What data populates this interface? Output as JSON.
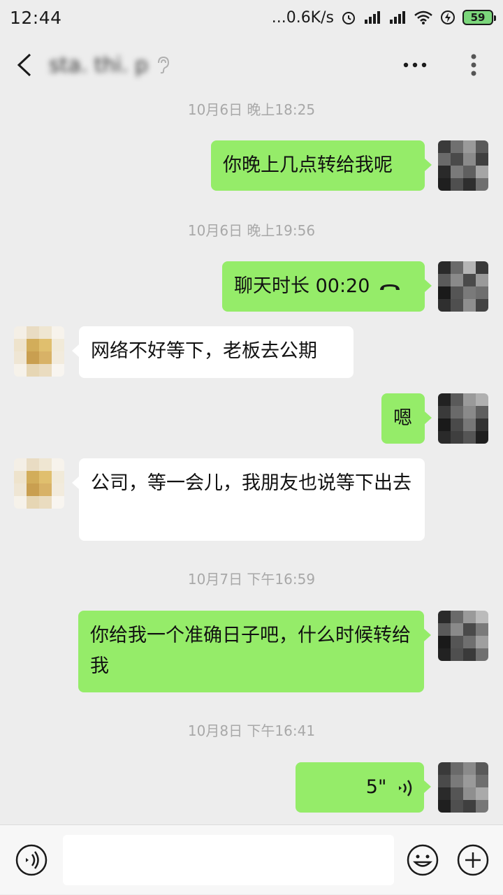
{
  "status_bar": {
    "time": "12:44",
    "network_speed": "...0.6K/s",
    "battery_level": "59"
  },
  "header": {
    "contact_name": "sta. thi. p"
  },
  "messages": [
    {
      "type": "timestamp",
      "text": "10月6日 晚上18:25"
    },
    {
      "type": "text",
      "sender": "me",
      "text": "你晚上几点转给我呢"
    },
    {
      "type": "timestamp",
      "text": "10月6日 晚上19:56"
    },
    {
      "type": "call",
      "sender": "me",
      "text": "聊天时长 00:20"
    },
    {
      "type": "text",
      "sender": "them",
      "text": "网络不好等下，老板去公期"
    },
    {
      "type": "text",
      "sender": "me",
      "text": "嗯"
    },
    {
      "type": "text",
      "sender": "them",
      "text": "公司，等一会儿，我朋友也说等下出去"
    },
    {
      "type": "timestamp",
      "text": "10月7日 下午16:59"
    },
    {
      "type": "text",
      "sender": "me",
      "text": "你给我一个准确日子吧，什么时候转给我"
    },
    {
      "type": "timestamp",
      "text": "10月8日 下午16:41"
    },
    {
      "type": "voice",
      "sender": "me",
      "text": "5\""
    }
  ],
  "input": {
    "value": ""
  },
  "icons": {
    "back": "back-arrow-icon",
    "ear": "ear-icon",
    "more": "more-dots-icon",
    "menu": "vertical-menu-icon",
    "voice": "voice-input-icon",
    "emoji": "emoji-icon",
    "plus": "plus-icon"
  },
  "colors": {
    "my_bubble": "#95ec69",
    "their_bubble": "#ffffff",
    "background": "#ededed"
  }
}
